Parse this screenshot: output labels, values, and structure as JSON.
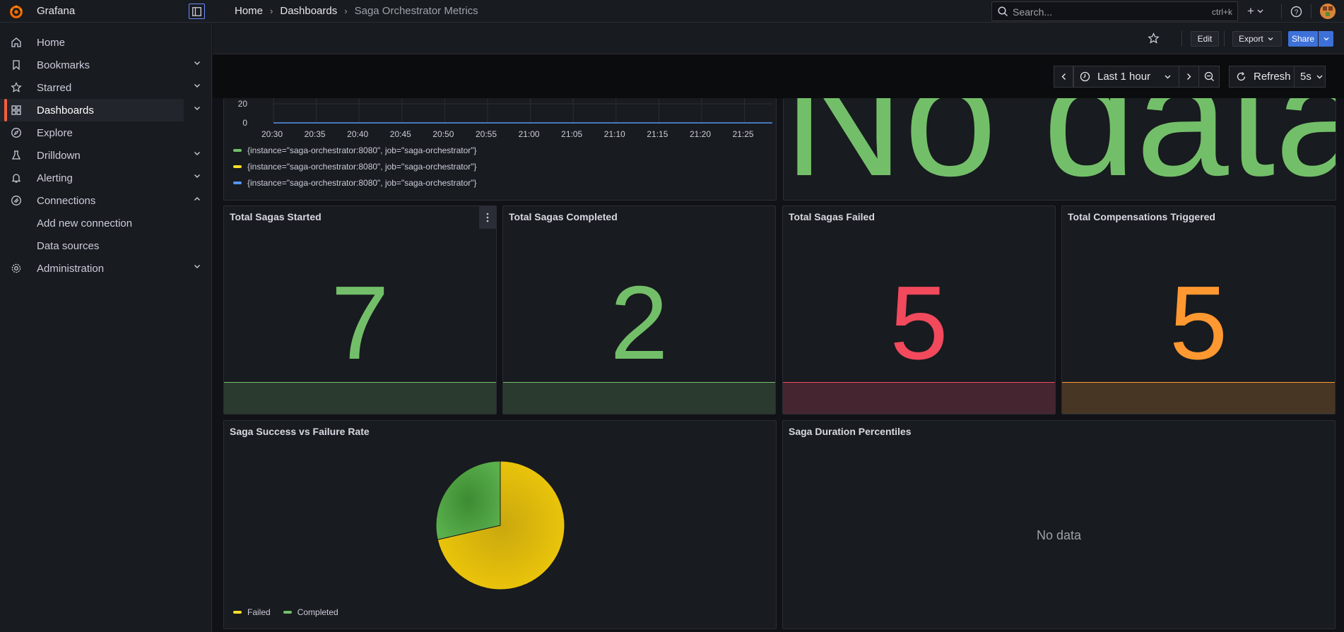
{
  "app": {
    "name": "Grafana"
  },
  "breadcrumb": [
    "Home",
    "Dashboards",
    "Saga Orchestrator Metrics"
  ],
  "search": {
    "placeholder": "Search...",
    "shortcut": "ctrl+k"
  },
  "sidebar": {
    "items": [
      {
        "label": "Home",
        "icon": "home-icon"
      },
      {
        "label": "Bookmarks",
        "icon": "bookmark-icon"
      },
      {
        "label": "Starred",
        "icon": "star-icon"
      },
      {
        "label": "Dashboards",
        "icon": "dashboards-icon"
      },
      {
        "label": "Explore",
        "icon": "compass-icon"
      },
      {
        "label": "Drilldown",
        "icon": "drilldown-icon"
      },
      {
        "label": "Alerting",
        "icon": "bell-icon"
      },
      {
        "label": "Connections",
        "icon": "connections-icon"
      },
      {
        "label": "Administration",
        "icon": "gear-icon"
      }
    ],
    "connections_children": [
      "Add new connection",
      "Data sources"
    ]
  },
  "toolbar": {
    "edit": "Edit",
    "export": "Export",
    "share": "Share"
  },
  "timepicker": {
    "range": "Last 1 hour",
    "refresh": "Refresh",
    "interval": "5s"
  },
  "timeseries_panel": {
    "y_ticks": [
      "20",
      "0"
    ],
    "x_ticks": [
      "20:30",
      "20:35",
      "20:40",
      "20:45",
      "20:50",
      "20:55",
      "21:00",
      "21:05",
      "21:10",
      "21:15",
      "21:20",
      "21:25"
    ],
    "legend": [
      {
        "label": "{instance=\"saga-orchestrator:8080\", job=\"saga-orchestrator\"}",
        "color": "#73bf69"
      },
      {
        "label": "{instance=\"saga-orchestrator:8080\", job=\"saga-orchestrator\"}",
        "color": "#fade2a"
      },
      {
        "label": "{instance=\"saga-orchestrator:8080\", job=\"saga-orchestrator\"}",
        "color": "#5794f2"
      }
    ]
  },
  "nodata_big": "No data",
  "stats": [
    {
      "title": "Total Sagas Started",
      "value": "7",
      "color": "#73bf69",
      "bg": "#2b3a2f"
    },
    {
      "title": "Total Sagas Completed",
      "value": "2",
      "color": "#73bf69",
      "bg": "#2b3a2f"
    },
    {
      "title": "Total Sagas Failed",
      "value": "5",
      "color": "#f2495c",
      "bg": "#452530"
    },
    {
      "title": "Total Compensations Triggered",
      "value": "5",
      "color": "#ff9830",
      "bg": "#483625"
    }
  ],
  "pie_panel": {
    "title": "Saga Success vs Failure Rate",
    "legend": [
      {
        "label": "Failed",
        "color": "#fade2a"
      },
      {
        "label": "Completed",
        "color": "#73bf69"
      }
    ]
  },
  "duration_panel": {
    "title": "Saga Duration Percentiles",
    "nodata": "No data"
  },
  "chart_data": {
    "type": "pie",
    "categories": [
      "Failed",
      "Completed"
    ],
    "values": [
      5,
      2
    ]
  }
}
